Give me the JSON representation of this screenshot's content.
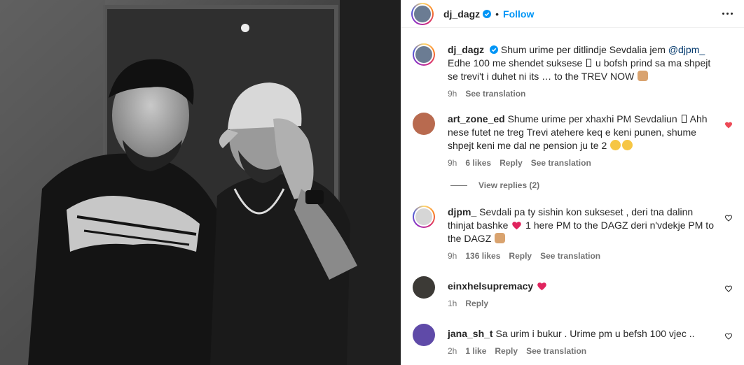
{
  "post": {
    "username": "dj_dagz",
    "follow_label": "Follow",
    "separator": "•"
  },
  "caption": {
    "username": "dj_dagz",
    "text_before": " Shum urime per ditlindje Sevdalia jem ",
    "mention": "@djpm_",
    "text_line2_a": "Edhe 100 me shendet suksese ",
    "text_line2_b": " u bofsh prind sa ma shpejt se trevi't i duhet ni its … to the TREV NOW ",
    "time": "9h",
    "see_translation": "See translation"
  },
  "comments": [
    {
      "username": "art_zone_ed",
      "text_a": " Shume urime per xhaxhi PM Sevdaliun ",
      "text_b": " Ahh nese futet ne treg Trevi atehere keq e keni punen, shume shpejt keni me dal ne pension ju te 2 ",
      "time": "9h",
      "likes": "6 likes",
      "reply": "Reply",
      "see_translation": "See translation",
      "liked": true
    },
    {
      "username": "djpm_",
      "text_a": " Sevdali pa ty sishin kon sukseset , deri tna dalinn thinjat bashke ",
      "text_b": " 1 here PM to the DAGZ deri n'vdekje PM to the DAGZ ",
      "time": "9h",
      "likes": "136 likes",
      "reply": "Reply",
      "see_translation": "See translation",
      "liked": false
    },
    {
      "username": "einxhelsupremacy",
      "time": "1h",
      "reply": "Reply",
      "liked": false
    },
    {
      "username": "jana_sh_t",
      "text_a": " Sa urim i bukur . Urime pm u befsh 100 vjec ..",
      "time": "2h",
      "likes": "1 like",
      "reply": "Reply",
      "see_translation": "See translation",
      "liked": false
    }
  ],
  "view_replies": "View replies (2)",
  "colors": {
    "link": "#0095f6",
    "mention": "#00376b",
    "muted": "#737373",
    "heart": "#ed4956"
  },
  "icons": [
    "verified-icon",
    "more-options-icon",
    "heart-icon",
    "heart-outline-icon",
    "grinning-sweat-emoji",
    "praying-hands-emoji",
    "red-heart-emoji"
  ]
}
